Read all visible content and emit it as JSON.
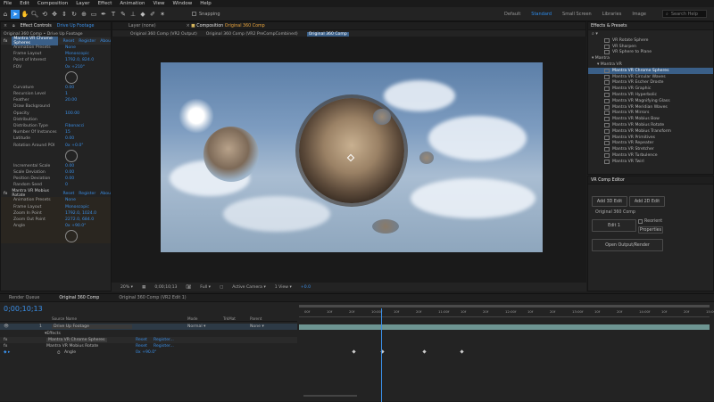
{
  "menu": [
    "File",
    "Edit",
    "Composition",
    "Layer",
    "Effect",
    "Animation",
    "View",
    "Window",
    "Help"
  ],
  "toolbar": {
    "snapping_label": "Snapping",
    "workspaces": [
      "Default",
      "Standard",
      "Small Screen",
      "Libraries",
      "Image"
    ],
    "active_workspace": "Standard",
    "search_placeholder": "Search Help"
  },
  "effect_controls": {
    "tab_label": "Effect Controls",
    "tab_layer": "Drive Up Footage",
    "subtitle": "Original 360 Comp • Drive Up Footage",
    "effect1_name": "Mantra VR Chrome Spheres",
    "effect1_reset": "Reset",
    "effect1_register": "Register",
    "effect1_about": "Abou",
    "rows": [
      {
        "label": "Animation Presets",
        "value": "None"
      },
      {
        "label": "Frame Layout",
        "value": "Monoscopic"
      },
      {
        "label": "Point of Interest",
        "value": "1792.0, 824.0"
      },
      {
        "label": "FOV",
        "value": "0x +210°"
      },
      {
        "label": "Curvature",
        "value": "0.00"
      },
      {
        "label": "Recursion Level",
        "value": "1"
      },
      {
        "label": "Feather",
        "value": "20.00"
      },
      {
        "label": "Draw Background",
        "value": ""
      },
      {
        "label": "Opacity",
        "value": "100.00"
      },
      {
        "label": "Distribution",
        "value": ""
      },
      {
        "label": "Distribution Type",
        "value": "Fibonacci"
      },
      {
        "label": "Number Of Instances",
        "value": "15"
      },
      {
        "label": "Latitude",
        "value": "0.00"
      },
      {
        "label": "Rotation Around POI",
        "value": "0x +0.0°"
      },
      {
        "label": "Incremental Scale",
        "value": "0.00"
      },
      {
        "label": "Scale Deviation",
        "value": "0.00"
      },
      {
        "label": "Position Deviation",
        "value": "0.00"
      },
      {
        "label": "Random Seed",
        "value": "0"
      }
    ],
    "effect2_name": "Mantra VR Mobius Rotate",
    "effect2_reset": "Reset",
    "effect2_register": "Register",
    "effect2_about": "Abou",
    "rows2": [
      {
        "label": "Animation Presets",
        "value": "None"
      },
      {
        "label": "Frame Layout",
        "value": "Monoscopic"
      },
      {
        "label": "Zoom In Point",
        "value": "1792.0, 1024.0"
      },
      {
        "label": "Zoom Out Point",
        "value": "2272.0, 684.0"
      },
      {
        "label": "Angle",
        "value": "0x +90.0°"
      }
    ]
  },
  "composition": {
    "layer_tab": "Layer (none)",
    "comp_tab": "Composition",
    "comp_tab_name": "Original 360 Comp",
    "breadcrumbs": [
      "Original 360 Comp (VR2 Output)",
      "Original 360 Comp (VR2 PreCompCombined)",
      "Original 360 Comp"
    ],
    "zoom": "20%",
    "timecode": "0;00;10;13",
    "resolution": "Full",
    "camera": "Active Camera",
    "view": "1 View",
    "exposure": "+0.0"
  },
  "effects_presets": {
    "title": "Effects & Presets",
    "items_top": [
      "VR Rotate Sphere",
      "VR Sharpen",
      "VR Sphere to Plane"
    ],
    "group": "Mantra",
    "subgroup": "Mantra VR",
    "items": [
      "Mantra VR Chrome Spheres",
      "Mantra VR Circular Waves",
      "Mantra VR Escher Droste",
      "Mantra VR Graphic",
      "Mantra VR Hyperbolic",
      "Mantra VR Magnifying Glass",
      "Mantra VR Meridian Waves",
      "Mantra VR Mirrors",
      "Mantra VR Mobius Bow",
      "Mantra VR Mobius Rotate",
      "Mantra VR Mobius Transform",
      "Mantra VR Primitives",
      "Mantra VR Repeater",
      "Mantra VR Stretcher",
      "Mantra VR Turbulence",
      "Mantra VR Twirl"
    ],
    "selected": "Mantra VR Chrome Spheres"
  },
  "vr_editor": {
    "title": "VR Comp Editor",
    "add_3d": "Add 3D Edit",
    "add_2d": "Add 2D Edit",
    "comp_label": "Original 360 Comp",
    "edit_label": "Edit 1",
    "reorient": "Reorient",
    "properties": "Properties",
    "open_output": "Open Output/Render"
  },
  "timeline": {
    "tabs": [
      "Render Queue",
      "Original 360 Comp",
      "Original 360 Comp (VR2 Edit 1)"
    ],
    "active_tab": "Original 360 Comp",
    "timecode": "0;00;10;13",
    "columns": {
      "source": "Source Name",
      "mode": "Mode",
      "trkmat": "TrkMat",
      "parent": "Parent"
    },
    "layer_index": "1",
    "layer_name": "Drive Up Footage",
    "layer_mode": "Normal",
    "layer_parent": "None",
    "effects_label": "Effects",
    "fx1": "Mantra VR Chrome Spheres",
    "fx2": "Mantra VR Mobius Rotate",
    "fx_reset": "Reset",
    "fx_register": "Register...",
    "angle_label": "Angle",
    "angle_value": "0x +90.0°",
    "ruler": [
      "00f",
      "10f",
      "20f",
      "10:00f",
      "10f",
      "20f",
      "11:00f",
      "10f",
      "20f",
      "12:00f",
      "10f",
      "20f",
      "13:00f",
      "10f",
      "20f",
      "14:00f",
      "10f",
      "20f",
      "15:00f"
    ]
  },
  "colors": {
    "accent": "#2d8ceb",
    "selection": "#3a5f88",
    "layer_bar": "#7aa9a6"
  }
}
